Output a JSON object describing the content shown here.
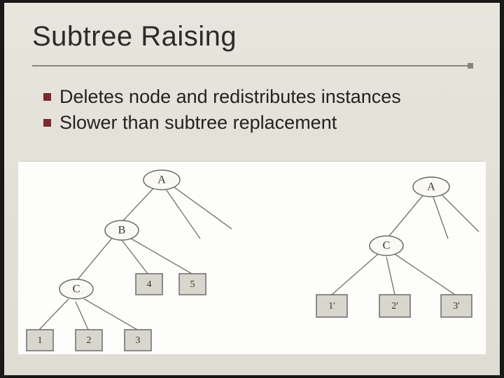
{
  "slide": {
    "title": "Subtree Raising",
    "bullets": [
      "Deletes node and redistributes instances",
      "Slower than subtree replacement"
    ]
  },
  "left_tree": {
    "nodes": {
      "A": "A",
      "B": "B",
      "C": "C",
      "l1": "1",
      "l2": "2",
      "l3": "3",
      "l4": "4",
      "l5": "5"
    }
  },
  "right_tree": {
    "nodes": {
      "A": "A",
      "C": "C",
      "l1": "1'",
      "l2": "2'",
      "l3": "3'"
    }
  }
}
